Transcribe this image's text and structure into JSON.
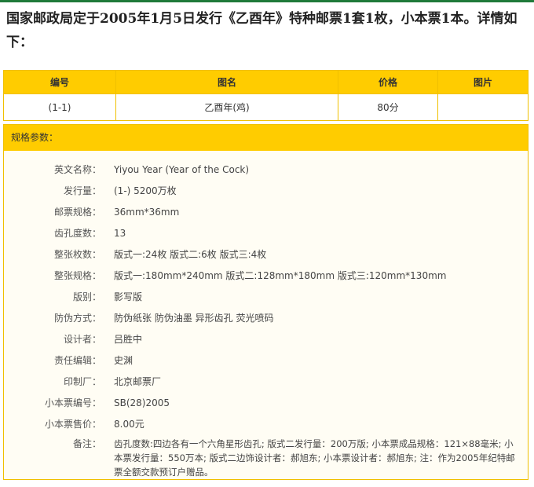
{
  "heading": "国家邮政局定于2005年1月5日发行《乙酉年》特种邮票1套1枚，小本票1本。详情如下：",
  "table": {
    "headers": [
      "编号",
      "图名",
      "价格",
      "图片"
    ],
    "rows": [
      [
        "(1-1)",
        "乙酉年(鸡)",
        "80分",
        ""
      ]
    ]
  },
  "spec": {
    "title": "规格参数：",
    "rows": [
      {
        "label": "英文名称：",
        "value": "Yiyou Year (Year of the Cock)"
      },
      {
        "label": "发行量：",
        "value": "(1-) 5200万枚"
      },
      {
        "label": "邮票规格：",
        "value": "36mm*36mm"
      },
      {
        "label": "齿孔度数：",
        "value": "13"
      },
      {
        "label": "整张枚数：",
        "value": "版式一:24枚 版式二:6枚 版式三:4枚"
      },
      {
        "label": "整张规格：",
        "value": "版式一:180mm*240mm 版式二:128mm*180mm 版式三:120mm*130mm"
      },
      {
        "label": "版别：",
        "value": "影写版"
      },
      {
        "label": "防伪方式：",
        "value": "防伪纸张 防伪油墨 异形齿孔 荧光喷码"
      },
      {
        "label": "设计者：",
        "value": "吕胜中"
      },
      {
        "label": "责任编辑：",
        "value": "史渊"
      },
      {
        "label": "印制厂：",
        "value": "北京邮票厂"
      },
      {
        "label": "小本票编号：",
        "value": "SB(28)2005"
      },
      {
        "label": "小本票售价：",
        "value": "8.00元"
      },
      {
        "label": "备注：",
        "value": "齿孔度数:四边各有一个六角星形齿孔; 版式二发行量：200万版; 小本票成品规格：121×88毫米; 小本票发行量：550万本; 版式二边饰设计者：郝旭东; 小本票设计者：郝旭东; 注：作为2005年纪特邮票全额交款预订户赠品。"
      }
    ]
  }
}
